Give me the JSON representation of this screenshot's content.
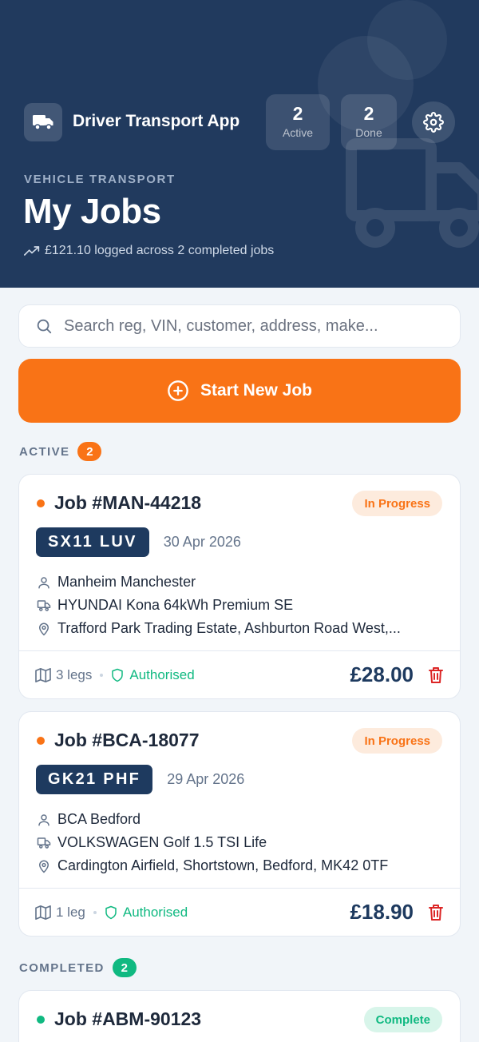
{
  "header": {
    "app_title": "Driver Transport App",
    "stats": {
      "active_count": "2",
      "active_label": "Active",
      "done_count": "2",
      "done_label": "Done"
    },
    "kicker": "VEHICLE TRANSPORT",
    "page_title": "My Jobs",
    "summary": "£121.10 logged across 2 completed jobs"
  },
  "search": {
    "placeholder": "Search reg, VIN, customer, address, make..."
  },
  "start_button": {
    "label": "Start New Job"
  },
  "sections": {
    "active": {
      "label": "ACTIVE",
      "count": "2"
    },
    "completed": {
      "label": "COMPLETED",
      "count": "2"
    }
  },
  "active_jobs": [
    {
      "job_id": "Job #MAN-44218",
      "status": "In Progress",
      "reg": "SX11 LUV",
      "date": "30 Apr 2026",
      "customer": "Manheim Manchester",
      "vehicle": "HYUNDAI Kona 64kWh Premium SE",
      "address": "Trafford Park Trading Estate, Ashburton Road West,...",
      "legs": "3 legs",
      "auth": "Authorised",
      "amount": "£28.00"
    },
    {
      "job_id": "Job #BCA-18077",
      "status": "In Progress",
      "reg": "GK21 PHF",
      "date": "29 Apr 2026",
      "customer": "BCA Bedford",
      "vehicle": "VOLKSWAGEN Golf 1.5 TSI Life",
      "address": "Cardington Airfield, Shortstown, Bedford, MK42 0TF",
      "legs": "1 leg",
      "auth": "Authorised",
      "amount": "£18.90"
    }
  ],
  "completed_jobs": [
    {
      "job_id": "Job #ABM-90123",
      "status": "Complete"
    }
  ],
  "colors": {
    "header_bg": "#213a5e",
    "accent_orange": "#f97316",
    "success_green": "#10b981",
    "navy": "#1e3a5f",
    "delete_red": "#dc2626"
  },
  "icons": [
    "truck-icon",
    "gear-icon",
    "trending-up-icon",
    "search-icon",
    "plus-circle-icon",
    "user-icon",
    "car-icon",
    "map-pin-icon",
    "map-icon",
    "shield-icon",
    "trash-icon"
  ]
}
